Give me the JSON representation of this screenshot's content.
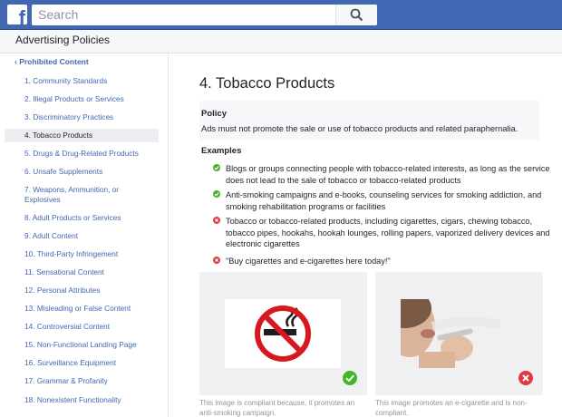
{
  "header": {
    "logo": "f",
    "search_placeholder": "Search",
    "search_icon": "magnifier-icon"
  },
  "subheader": {
    "title": "Advertising Policies"
  },
  "sidebar": {
    "back_label": "Prohibited Content",
    "items": [
      "1. Community Standards",
      "2. Illegal Products or Services",
      "3. Discriminatory Practices",
      "4. Tobacco Products",
      "5. Drugs & Drug-Related Products",
      "6. Unsafe Supplements",
      "7. Weapons, Ammunition, or Explosives",
      "8. Adult Products or Services",
      "9. Adult Content",
      "10. Third-Party Infringement",
      "11. Sensational Content",
      "12. Personal Attributes",
      "13. Misleading or False Content",
      "14. Controversial Content",
      "15. Non-Functional Landing Page",
      "16. Surveillance Equipment",
      "17. Grammar & Profanity",
      "18. Nonexistent Functionality"
    ],
    "active_index": 3
  },
  "main": {
    "title": "4. Tobacco Products",
    "policy_heading": "Policy",
    "policy_text": "Ads must not promote the sale or use of tobacco products and related paraphernalia.",
    "examples_heading": "Examples",
    "examples": [
      {
        "status": "compliant",
        "text": "Blogs or groups connecting people with tobacco-related interests, as long as the service does not lead to the sale of tobacco or tobacco-related products"
      },
      {
        "status": "compliant",
        "text": "Anti-smoking campaigns and e-books, counseling services for smoking addiction, and smoking rehabilitation programs or facilities"
      },
      {
        "status": "non-compliant",
        "text": "Tobacco or tobacco-related products, including cigarettes, cigars, chewing tobacco, tobacco pipes, hookahs, hookah lounges, rolling papers, vaporized delivery devices and electronic cigarettes"
      },
      {
        "status": "non-compliant",
        "text": "\"Buy cigarettes and e-cigarettes here today!\""
      }
    ],
    "cards": [
      {
        "image": "no-smoking-sign",
        "status": "compliant",
        "caption": "This image is compliant because, it promotes an anti-smoking campaign."
      },
      {
        "image": "person-vaping-photo",
        "status": "non-compliant",
        "caption": "This image promotes an e-cigarette and is non-compliant."
      }
    ]
  },
  "colors": {
    "brand_blue": "#4267b2",
    "link_blue": "#4267b2",
    "ok_green": "#42b72a",
    "bad_red": "#e0393e",
    "no_smoking_red": "#d7191f"
  }
}
